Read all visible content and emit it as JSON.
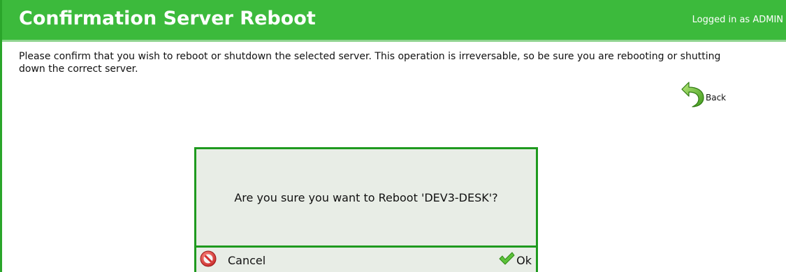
{
  "header": {
    "title": "Confirmation Server Reboot",
    "user_status": "Logged in as ADMIN"
  },
  "intro": {
    "text": "Please confirm that you wish to reboot or shutdown the selected server. This operation is irreversable, so be sure you are rebooting or shutting down the correct server."
  },
  "back": {
    "label": "Back",
    "icon": "back-arrow-icon"
  },
  "dialog": {
    "message": "Are you sure you want to Reboot 'DEV3-DESK'?",
    "cancel_label": "Cancel",
    "cancel_icon": "no-entry-icon",
    "ok_label": "Ok",
    "ok_icon": "checkmark-icon"
  },
  "colors": {
    "header_green": "#3cba3c",
    "border_green": "#1e9a1e",
    "dialog_bg": "#e8ede6"
  }
}
